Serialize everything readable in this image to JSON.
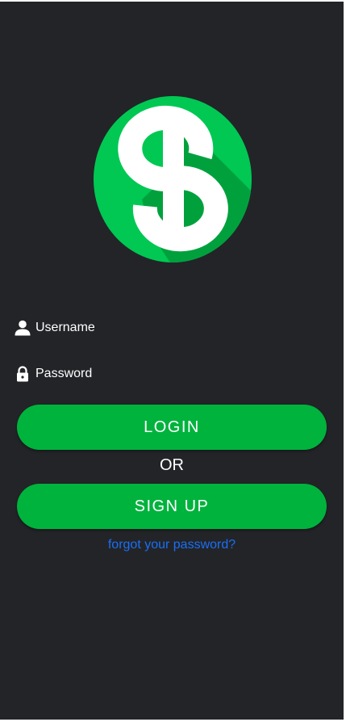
{
  "logo": {
    "name": "dollar-logo",
    "colors": {
      "circle": "#00c853",
      "shadow": "#00a13d",
      "symbol": "#ffffff"
    }
  },
  "form": {
    "username_placeholder": "Username",
    "password_placeholder": "Password"
  },
  "buttons": {
    "login_label": "LOGIN",
    "signup_label": "SIGN UP"
  },
  "divider_text": "OR",
  "forgot_link": "forgot your password?",
  "colors": {
    "background": "#232428",
    "accent": "#00b33d",
    "link": "#1a6ff5"
  }
}
